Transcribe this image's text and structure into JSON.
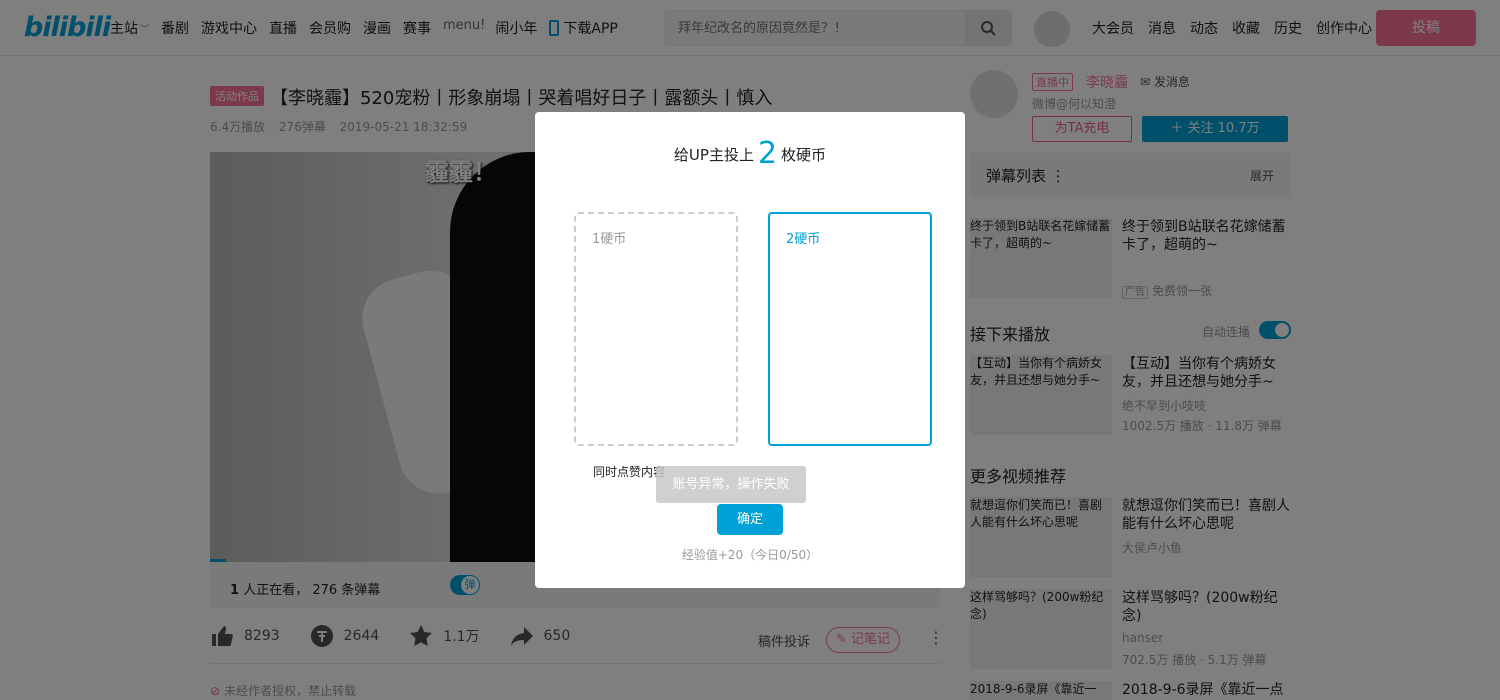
{
  "header": {
    "logo": "bilibili",
    "nav": [
      "主站",
      "番剧",
      "游戏中心",
      "直播",
      "会员购",
      "漫画",
      "赛事"
    ],
    "menu_img_alt": "menu!",
    "nav_extra": "闹小年",
    "download_app": "下载APP",
    "search_placeholder": "拜年纪改名的原因竟然是？！",
    "right_nav": [
      "大会员",
      "消息",
      "动态",
      "收藏",
      "历史",
      "创作中心"
    ],
    "upload": "投稿"
  },
  "video": {
    "activity_badge": "活动作品",
    "title": "【李晓霾】520宠粉丨形象崩塌丨哭着唱好日子丨露额头丨慎入",
    "plays": "6.4万播放",
    "danmaku_count": "276弹幕",
    "date": "2019-05-21 18:32:59",
    "overlay_danmaku": "霾霾！",
    "viewers_num": "1",
    "viewers_text": "人正在看，",
    "danmaku_text": "276 条弹幕"
  },
  "actions": {
    "like": "8293",
    "coin": "2644",
    "fav": "1.1万",
    "share": "650",
    "report": "稿件投诉",
    "note": "记笔记",
    "copyright": "未经作者授权，禁止转载"
  },
  "up": {
    "live": "直播中",
    "name": "李晓霾",
    "message": "发消息",
    "desc": "微博@何以知澄",
    "charge": "为TA充电",
    "follow": "＋  关注 10.7万"
  },
  "sidebar": {
    "danmaku_list": "弹幕列表",
    "expand": "展开",
    "ad": {
      "thumb": "终于领到B站联名花嫁储蓄卡了，超萌的~",
      "title": "终于领到B站联名花嫁储蓄卡了，超萌的~",
      "tag": "广告",
      "sub": "免费领一张"
    },
    "next_play": "接下来播放",
    "autoplay": "自动连播",
    "next": {
      "thumb": "【互动】当你有个病娇女友，并且还想与她分手~",
      "title": "【互动】当你有个病娇女友，并且还想与她分手~",
      "author": "绝不早到小吱吱",
      "stats": "1002.5万 播放 · 11.8万 弹幕"
    },
    "more": "更多视频推荐",
    "rec1": {
      "thumb": "就想逗你们笑而已！喜剧人能有什么坏心思呢",
      "title": "就想逗你们笑而已！喜剧人能有什么坏心思呢",
      "author": "大侯卢小鱼"
    },
    "rec2": {
      "thumb": "这样骂够吗？(200w粉纪念)",
      "title": "这样骂够吗？(200w粉纪念)",
      "author": "hanser",
      "stats": "702.5万 播放 · 5.1万 弹幕"
    },
    "rec3": {
      "thumb": "2018-9-6录屏《靠近一",
      "title": "2018-9-6录屏《靠近一点"
    }
  },
  "modal": {
    "title_pre": "给UP主投上",
    "coin_num": "2",
    "title_post": "枚硬币",
    "option1": "1硬币",
    "option2": "2硬币",
    "like_too": "同时点赞内容",
    "toast": "账号异常，操作失败",
    "confirm": "确定",
    "exp": "经验值+20（今日0/50）"
  },
  "colors": {
    "accent": "#00a1d6",
    "pink": "#fb7299"
  }
}
